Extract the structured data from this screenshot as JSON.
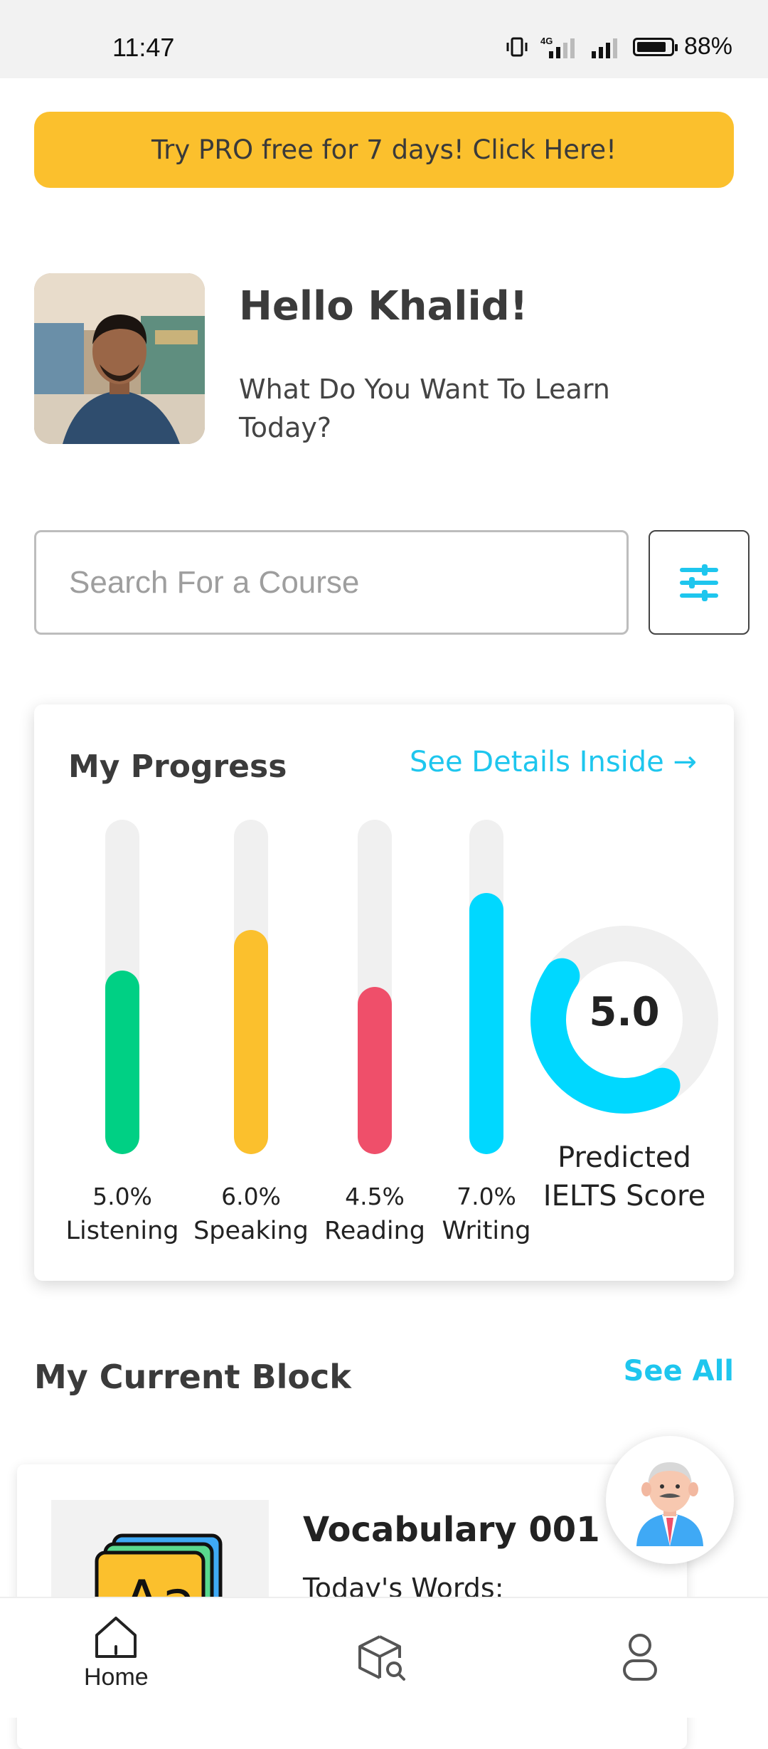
{
  "status_bar": {
    "time": "11:47",
    "battery_percent": "88%",
    "battery_level": 0.88,
    "network": "4G"
  },
  "promo": {
    "label": "Try PRO free for 7 days! Click Here!",
    "color": "#fbc02d"
  },
  "profile": {
    "greeting": "Hello Khalid!",
    "subtitle": "What Do You Want To Learn Today?"
  },
  "search": {
    "placeholder": "Search For a Course"
  },
  "progress": {
    "title": "My Progress",
    "details_link": "See Details Inside →",
    "bars": [
      {
        "value": "5.0%",
        "label": "Listening",
        "fraction": 0.55,
        "color": "#00d084"
      },
      {
        "value": "6.0%",
        "label": "Speaking",
        "fraction": 0.67,
        "color": "#fbc02d"
      },
      {
        "value": "4.5%",
        "label": "Reading",
        "fraction": 0.5,
        "color": "#ef4f6a"
      },
      {
        "value": "7.0%",
        "label": "Writing",
        "fraction": 0.78,
        "color": "#00d8ff"
      }
    ],
    "score": "5.0",
    "score_fraction": 0.62,
    "score_label": "Predicted IELTS Score",
    "accent": "#1ec6ee"
  },
  "current_block": {
    "title": "My Current Block",
    "see_all": "See All",
    "item": {
      "title": "Vocabulary 001",
      "subtitle": "Today's Words:"
    }
  },
  "bottom_nav": [
    {
      "label": "Home",
      "icon": "home-icon",
      "active": true
    },
    {
      "label": "",
      "icon": "explore-box-icon",
      "active": false
    },
    {
      "label": "",
      "icon": "profile-icon",
      "active": false
    }
  ]
}
